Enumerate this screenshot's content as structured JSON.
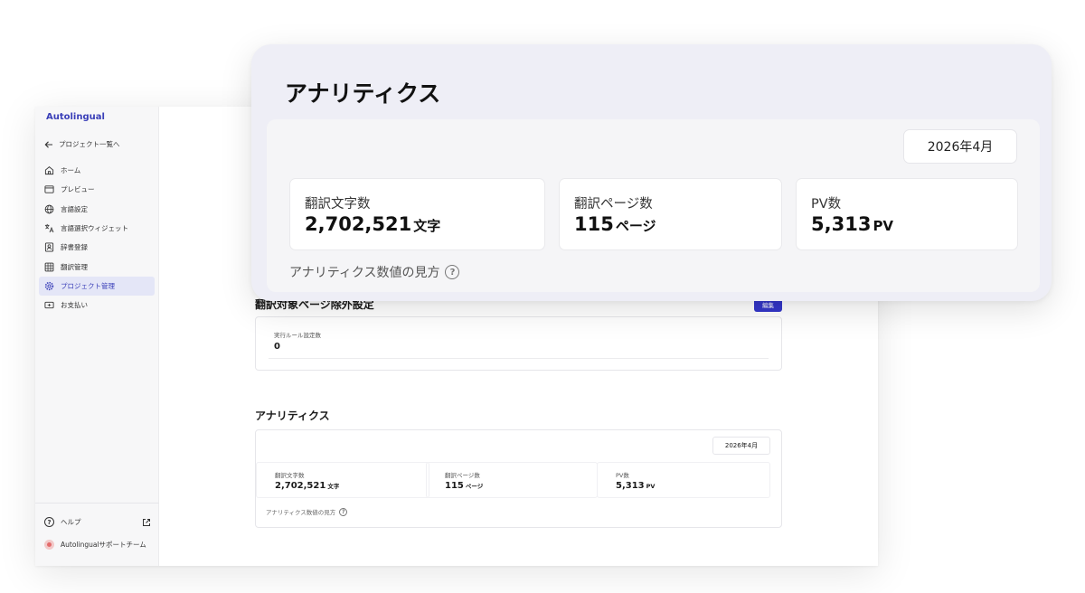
{
  "brand": "Autolingual",
  "sidebar": {
    "back_label": "プロジェクト一覧へ",
    "items": [
      {
        "label": "ホーム",
        "icon": "home-icon"
      },
      {
        "label": "プレビュー",
        "icon": "browser-window-icon"
      },
      {
        "label": "言語設定",
        "icon": "globe-icon"
      },
      {
        "label": "言語選択ウィジェット",
        "icon": "translate-icon"
      },
      {
        "label": "辞書登録",
        "icon": "dictionary-icon"
      },
      {
        "label": "翻訳管理",
        "icon": "table-icon"
      },
      {
        "label": "プロジェクト管理",
        "icon": "gear-icon",
        "active": true
      },
      {
        "label": "お支払い",
        "icon": "payment-icon"
      }
    ],
    "help_label": "ヘルプ",
    "user_label": "Autolingualサポートチーム"
  },
  "main": {
    "rules_section_title": "翻訳対象ページ除外設定",
    "edit_button": "編集",
    "rule_label": "実行ルール設定数",
    "rule_value": "0",
    "analytics_title": "アナリティクス",
    "date": "2026年4月",
    "stats": [
      {
        "label": "翻訳文字数",
        "value": "2,702,521",
        "unit": "文字"
      },
      {
        "label": "翻訳ページ数",
        "value": "115",
        "unit": "ページ"
      },
      {
        "label": "PV数",
        "value": "5,313",
        "unit": "PV"
      }
    ],
    "help_link": "アナリティクス数値の見方"
  },
  "overlay": {
    "title": "アナリティクス",
    "date": "2026年4月",
    "stats": [
      {
        "label": "翻訳文字数",
        "value": "2,702,521",
        "unit": "文字"
      },
      {
        "label": "翻訳ページ数",
        "value": "115",
        "unit": "ページ"
      },
      {
        "label": "PV数",
        "value": "5,313",
        "unit": "PV"
      }
    ],
    "help_link": "アナリティクス数値の見方"
  },
  "colors": {
    "accent": "#3a3fb8",
    "button": "#3437c9",
    "active_bg": "#e4e6f7"
  }
}
